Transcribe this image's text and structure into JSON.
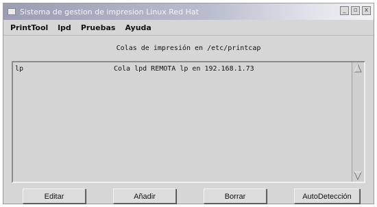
{
  "window": {
    "title": "Sistema de gestion de impresion Linux Red Hat",
    "controls": {
      "minimize": "_",
      "maximize": "▫",
      "close": "x"
    }
  },
  "menubar": {
    "items": [
      "PrintTool",
      "lpd",
      "Pruebas",
      "Ayuda"
    ]
  },
  "queue_list": {
    "header": "Colas de impresión en /etc/printcap",
    "rows": [
      {
        "name": "lp",
        "description": "Cola lpd REMOTA lp en 192.168.1.73"
      }
    ]
  },
  "buttons": {
    "edit": "Editar",
    "add": "Añadir",
    "delete": "Borrar",
    "autodetect": "AutoDetección"
  },
  "icons": {
    "scroll_up": "triangle-up-icon",
    "scroll_down": "triangle-down-icon",
    "window": "window-icon"
  }
}
